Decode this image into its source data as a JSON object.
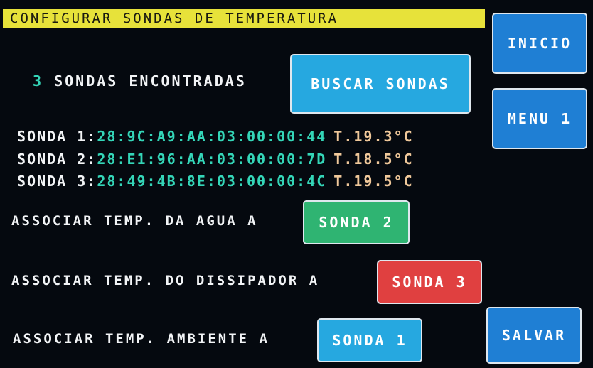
{
  "title": "CONFIGURAR SONDAS DE TEMPERATURA",
  "nav": {
    "inicio": "INICIO",
    "menu": "MENU 1"
  },
  "search": {
    "count": "3",
    "found_label": "SONDAS ENCONTRADAS",
    "button": "BUSCAR SONDAS"
  },
  "probes": [
    {
      "name": "SONDA 1",
      "address": "28:9C:A9:AA:03:00:00:44",
      "temp": "T.19.3°C"
    },
    {
      "name": "SONDA 2",
      "address": "28:E1:96:AA:03:00:00:7D",
      "temp": "T.18.5°C"
    },
    {
      "name": "SONDA 3",
      "address": "28:49:4B:8E:03:00:00:4C",
      "temp": "T.19.5°C"
    }
  ],
  "associations": {
    "water": {
      "label": "ASSOCIAR TEMP. DA AGUA A",
      "value": "SONDA 2",
      "color": "#2fb472"
    },
    "heatsink": {
      "label": "ASSOCIAR TEMP. DO DISSIPADOR A",
      "value": "SONDA 3",
      "color": "#e04040"
    },
    "ambient": {
      "label": "ASSOCIAR TEMP. AMBIENTE A",
      "value": "SONDA 1",
      "color": "#26a8e0"
    }
  },
  "save_label": "SALVAR"
}
